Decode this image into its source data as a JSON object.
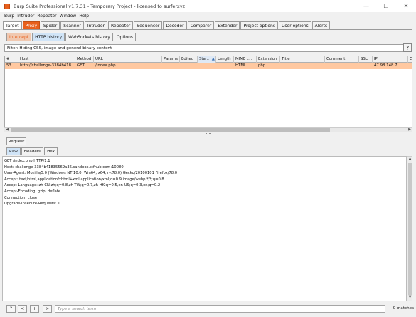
{
  "window": {
    "title": "Burp Suite Professional v1.7.31 - Temporary Project - licensed to surferxyz",
    "minimize": "—",
    "maximize": "☐",
    "close": "✕"
  },
  "menu": [
    "Burp",
    "Intruder",
    "Repeater",
    "Window",
    "Help"
  ],
  "main_tabs": [
    "Target",
    "Proxy",
    "Spider",
    "Scanner",
    "Intruder",
    "Repeater",
    "Sequencer",
    "Decoder",
    "Comparer",
    "Extender",
    "Project options",
    "User options",
    "Alerts"
  ],
  "main_active": "Proxy",
  "proxy_tabs": [
    "Intercept",
    "HTTP history",
    "WebSockets history",
    "Options"
  ],
  "proxy_active": "HTTP history",
  "filter": {
    "text": "Filter: Hiding CSS, image and general binary content",
    "help": "?"
  },
  "table": {
    "columns": [
      "#",
      "Host",
      "Method",
      "URL",
      "Params",
      "Edited",
      "Sta...",
      "Length",
      "MIME t...",
      "Extension",
      "Title",
      "Comment",
      "SSL",
      "IP",
      "C"
    ],
    "sort_indicator": "▲",
    "rows": [
      {
        "num": "53",
        "host": "http://challenge-3384b418...",
        "method": "GET",
        "url": "/index.php",
        "params": "",
        "edited": "",
        "status": "",
        "length": "",
        "mime": "HTML",
        "extension": "php",
        "title": "",
        "comment": "",
        "ssl": "",
        "ip": "47.98.148.7"
      }
    ]
  },
  "request": {
    "panel_tab": "Request",
    "subtabs": [
      "Raw",
      "Headers",
      "Hex"
    ],
    "subtab_active": "Raw",
    "lines": [
      "GET /index.php HTTP/1.1",
      "Host: challenge-3384b41835569a36.sandbox.ctfhub.com:10080",
      "User-Agent: Mozilla/5.0 (Windows NT 10.0; Win64; x64; rv:78.0) Gecko/20100101 Firefox/78.0",
      "Accept: text/html,application/xhtml+xml,application/xml;q=0.9,image/webp,*/*;q=0.8",
      "Accept-Language: zh-CN,zh;q=0.8,zh-TW;q=0.7,zh-HK;q=0.5,en-US;q=0.3,en;q=0.2",
      "Accept-Encoding: gzip, deflate",
      "Connection: close",
      "Upgrade-Insecure-Requests: 1"
    ]
  },
  "search": {
    "placeholder": "Type a search term",
    "matches": "0 matches",
    "buttons": [
      "?",
      "<",
      "+",
      ">"
    ]
  },
  "colors": {
    "accent": "#e8601c",
    "selected_row": "#ffc8a0"
  }
}
